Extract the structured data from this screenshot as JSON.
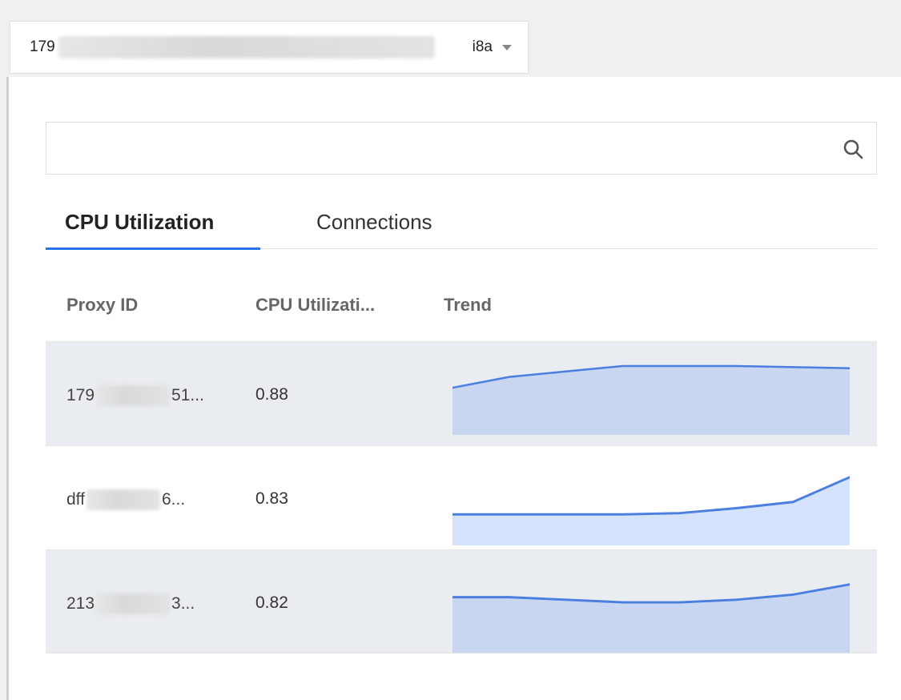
{
  "instance_select": {
    "value_prefix": "179",
    "value_suffix": "i8a",
    "caret_icon": "caret-down-icon"
  },
  "search": {
    "placeholder": "",
    "icon": "search-icon"
  },
  "tabs": [
    {
      "label": "CPU Utilization",
      "active": true
    },
    {
      "label": "Connections",
      "active": false
    }
  ],
  "table": {
    "columns": [
      "Proxy ID",
      "CPU Utilizati...",
      "Trend"
    ],
    "rows": [
      {
        "id_prefix": "179",
        "id_suffix": "51...",
        "value": "0.88",
        "trend": [
          0.86,
          0.87,
          0.875,
          0.88,
          0.88,
          0.88,
          0.879,
          0.878
        ],
        "fill": "#c8d6f2"
      },
      {
        "id_prefix": "dff",
        "id_suffix": "6...",
        "value": "0.83",
        "trend": [
          0.8,
          0.8,
          0.8,
          0.8,
          0.801,
          0.805,
          0.81,
          0.83
        ],
        "fill": "#d5e2fb"
      },
      {
        "id_prefix": "213",
        "id_suffix": "3...",
        "value": "0.82",
        "trend": [
          0.81,
          0.81,
          0.808,
          0.806,
          0.806,
          0.808,
          0.812,
          0.82
        ],
        "fill": "#c8d6f2"
      }
    ]
  },
  "colors": {
    "accent": "#2d73e8",
    "trend_line": "#4a7fe0"
  }
}
